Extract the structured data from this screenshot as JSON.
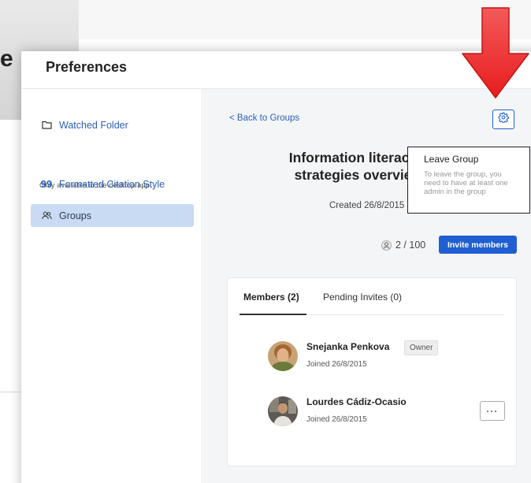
{
  "background": {
    "partial_letter": "e"
  },
  "modal": {
    "title": "Preferences"
  },
  "sidebar": {
    "items": [
      {
        "label": "Watched Folder",
        "icon": "folder-icon"
      },
      {
        "label": "Formatted Citation Style",
        "icon": "quote-icon"
      },
      {
        "label": "Groups",
        "icon": "groups-icon"
      }
    ],
    "note": "Only available in the desktop app"
  },
  "group": {
    "back_label": "< Back to Groups",
    "title_line1": "Information literacy",
    "title_line2": "strategies overvie",
    "created": "Created 26/8/2015",
    "member_count": "2 / 100",
    "invite_label": "Invite members"
  },
  "tabs": [
    {
      "label": "Members (2)",
      "active": true
    },
    {
      "label": "Pending Invites (0)",
      "active": false
    }
  ],
  "members": [
    {
      "name": "Snejanka Penkova",
      "joined": "Joined 26/8/2015",
      "badge": "Owner"
    },
    {
      "name": "Lourdes Cádiz-Ocasio",
      "joined": "Joined 26/8/2015",
      "more_label": "···"
    }
  ],
  "tooltip": {
    "title": "Leave Group",
    "description": "To leave the group, you need to have at least one admin in the group"
  },
  "colors": {
    "accent": "#1f5fd1",
    "link": "#2c5fb8",
    "sidebar_active": "#c9dbf3",
    "arrow": "#ee2b2b"
  }
}
